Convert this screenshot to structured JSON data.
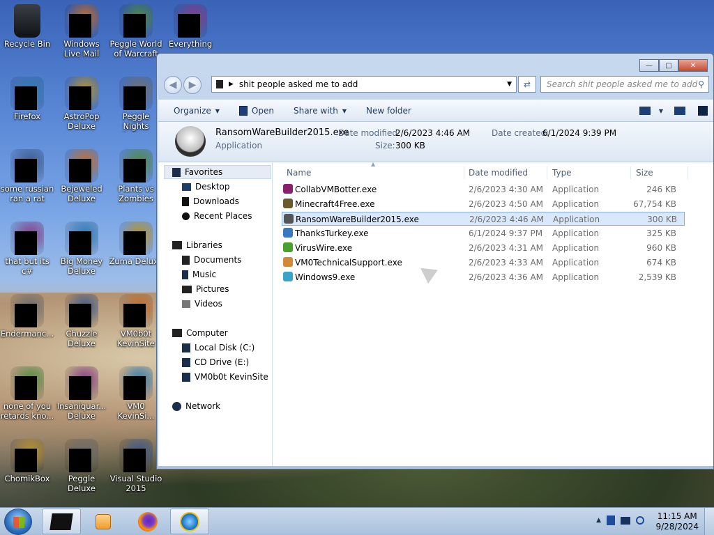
{
  "desktop": {
    "icons": [
      {
        "label": "Recycle Bin",
        "icon": "recycle-bin-icon",
        "col": 0,
        "row": 0,
        "covered": false
      },
      {
        "label": "Windows Live Mail",
        "icon": "mail-icon",
        "col": 1,
        "row": 0,
        "covered": true
      },
      {
        "label": "Peggle World of Warcraft",
        "icon": "peggle-icon",
        "col": 2,
        "row": 0,
        "covered": true
      },
      {
        "label": "Everything",
        "icon": "search-app-icon",
        "col": 3,
        "row": 0,
        "covered": true
      },
      {
        "label": "Firefox",
        "icon": "firefox-icon",
        "col": 0,
        "row": 1,
        "covered": true
      },
      {
        "label": "AstroPop Deluxe",
        "icon": "game-icon",
        "col": 1,
        "row": 1,
        "covered": true
      },
      {
        "label": "Peggle Nights Deluxe",
        "icon": "peggle-icon",
        "col": 2,
        "row": 1,
        "covered": true
      },
      {
        "label": "some russian ran a rat",
        "icon": "app-icon",
        "col": 0,
        "row": 2,
        "covered": true
      },
      {
        "label": "Bejeweled Deluxe",
        "icon": "game-icon",
        "col": 1,
        "row": 2,
        "covered": true
      },
      {
        "label": "Plants vs Zombies",
        "icon": "game-icon",
        "col": 2,
        "row": 2,
        "covered": true
      },
      {
        "label": "that but its c#",
        "icon": "app-icon",
        "col": 0,
        "row": 3,
        "covered": true
      },
      {
        "label": "Big Money Deluxe",
        "icon": "game-icon",
        "col": 1,
        "row": 3,
        "covered": true
      },
      {
        "label": "Zuma Deluxe",
        "icon": "game-icon",
        "col": 2,
        "row": 3,
        "covered": true
      },
      {
        "label": "Endermanc...",
        "icon": "app-icon",
        "col": 0,
        "row": 4,
        "covered": true
      },
      {
        "label": "Chuzzle Deluxe",
        "icon": "game-icon",
        "col": 1,
        "row": 4,
        "covered": true
      },
      {
        "label": "VM0b0t KevinSite",
        "icon": "app-icon",
        "col": 2,
        "row": 4,
        "covered": true
      },
      {
        "label": "none of you retards kno...",
        "icon": "app-icon",
        "col": 0,
        "row": 5,
        "covered": true
      },
      {
        "label": "Insaniquar... Deluxe",
        "icon": "game-icon",
        "col": 1,
        "row": 5,
        "covered": true
      },
      {
        "label": "VM0 KevinSi...",
        "icon": "app-icon",
        "col": 2,
        "row": 5,
        "covered": true
      },
      {
        "label": "ChomikBox",
        "icon": "app-icon",
        "col": 0,
        "row": 6,
        "covered": true
      },
      {
        "label": "Peggle Deluxe",
        "icon": "peggle-icon",
        "col": 1,
        "row": 6,
        "covered": true
      },
      {
        "label": "Visual Studio 2015",
        "icon": "visual-studio-icon",
        "col": 2,
        "row": 6,
        "covered": true
      }
    ]
  },
  "window": {
    "controls": {
      "minimize": "—",
      "maximize": "□",
      "close": "✕"
    },
    "address": {
      "path": "shit people asked me to add"
    },
    "search": {
      "placeholder": "Search shit people asked me to add"
    },
    "commands": {
      "organize": "Organize",
      "open": "Open",
      "share_with": "Share with",
      "new_folder": "New folder"
    },
    "details": {
      "name": "RansomWareBuilder2015.exe",
      "type": "Application",
      "date_modified_label": "Date modified:",
      "date_modified": "2/6/2023 4:46 AM",
      "date_created_label": "Date created:",
      "date_created": "6/1/2024 9:39 PM",
      "size_label": "Size:",
      "size": "300 KB"
    },
    "nav": {
      "favorites": "Favorites",
      "desktop": "Desktop",
      "downloads": "Downloads",
      "recent_places": "Recent Places",
      "libraries": "Libraries",
      "documents": "Documents",
      "music": "Music",
      "pictures": "Pictures",
      "videos": "Videos",
      "computer": "Computer",
      "local_disk": "Local Disk (C:)",
      "cd_drive": "CD Drive (E:)",
      "vm_site": "VM0b0t KevinSite",
      "network": "Network"
    },
    "columns": {
      "name": "Name",
      "date_modified": "Date modified",
      "type": "Type",
      "size": "Size"
    },
    "files": [
      {
        "name": "CollabVMBotter.exe",
        "date": "2/6/2023 4:30 AM",
        "type": "Application",
        "size": "246 KB",
        "color": "#8a1f6b",
        "selected": false
      },
      {
        "name": "Minecraft4Free.exe",
        "date": "2/6/2023 4:50 AM",
        "type": "Application",
        "size": "67,754 KB",
        "color": "#6b5a2e",
        "selected": false
      },
      {
        "name": "RansomWareBuilder2015.exe",
        "date": "2/6/2023 4:46 AM",
        "type": "Application",
        "size": "300 KB",
        "color": "#555555",
        "selected": true
      },
      {
        "name": "ThanksTurkey.exe",
        "date": "6/1/2024 9:37 PM",
        "type": "Application",
        "size": "325 KB",
        "color": "#3b78c2",
        "selected": false
      },
      {
        "name": "VirusWire.exe",
        "date": "2/6/2023 4:31 AM",
        "type": "Application",
        "size": "960 KB",
        "color": "#4aa02c",
        "selected": false
      },
      {
        "name": "VM0TechnicalSupport.exe",
        "date": "2/6/2023 4:33 AM",
        "type": "Application",
        "size": "674 KB",
        "color": "#d28a3a",
        "selected": false
      },
      {
        "name": "Windows9.exe",
        "date": "2/6/2023 4:36 AM",
        "type": "Application",
        "size": "2,539 KB",
        "color": "#3aa3c9",
        "selected": false
      }
    ]
  },
  "taskbar": {
    "time": "11:15 AM",
    "date": "9/28/2024"
  }
}
